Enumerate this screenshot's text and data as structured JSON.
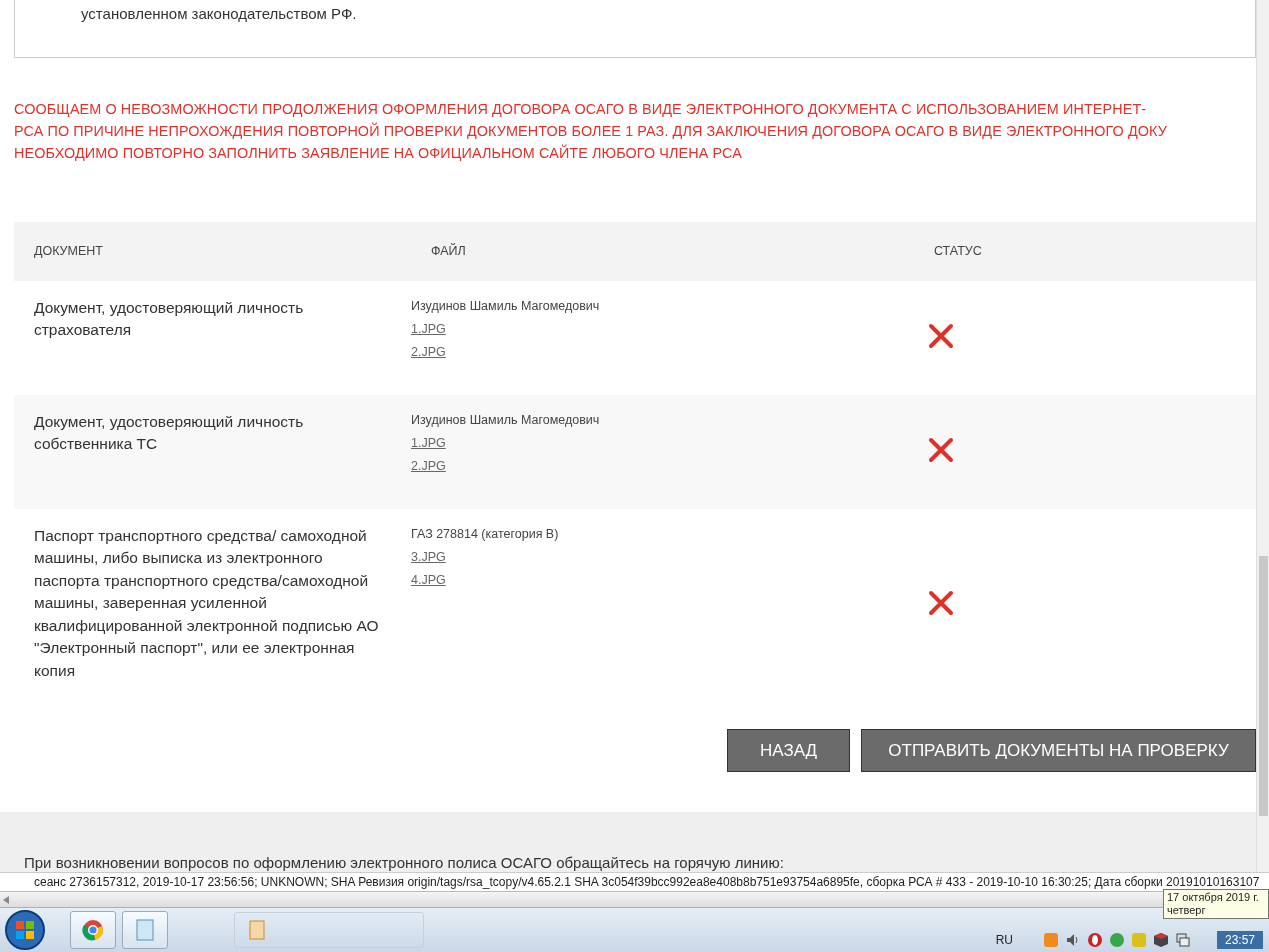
{
  "notice_box": {
    "text": "установленном законодательством РФ."
  },
  "message": {
    "lines": [
      "СООБЩАЕМ О НЕВОЗМОЖНОСТИ ПРОДОЛЖЕНИЯ ОФОРМЛЕНИЯ ДОГОВОРА ОСАГО В ВИДЕ ЭЛЕКТРОННОГО ДОКУМЕНТА С ИСПОЛЬЗОВАНИЕМ ИНТЕРНЕТ-",
      "РСА ПО ПРИЧИНЕ НЕПРОХОЖДЕНИЯ ПОВТОРНОЙ ПРОВЕРКИ ДОКУМЕНТОВ БОЛЕЕ 1 РАЗ. ДЛЯ ЗАКЛЮЧЕНИЯ ДОГОВОРА ОСАГО В ВИДЕ ЭЛЕКТРОННОГО ДОКУ",
      "НЕОБХОДИМО ПОВТОРНО ЗАПОЛНИТЬ ЗАЯВЛЕНИЕ НА ОФИЦИАЛЬНОМ САЙТЕ ЛЮБОГО ЧЛЕНА РСА"
    ]
  },
  "table": {
    "columns": [
      "ДОКУМЕНТ",
      "ФАЙЛ",
      "СТАТУС"
    ],
    "rows": [
      {
        "document": "Документ, удостоверяющий личность страхователя",
        "owner": "Изудинов Шамиль Магомедович",
        "files": [
          "1.JPG",
          "2.JPG"
        ],
        "accepted": false
      },
      {
        "document": "Документ, удостоверяющий личность собственника ТС",
        "owner": "Изудинов Шамиль Магомедович",
        "files": [
          "1.JPG",
          "2.JPG"
        ],
        "accepted": false
      },
      {
        "document": "Паспорт транспортного средства/ самоходной машины, либо выписка из электронного паспорта транспортного средства/самоходной машины, заверенная усиленной квалифицированной электронной подписью АО \"Электронный паспорт\", или ее электронная копия",
        "owner": "ГАЗ 278814 (категория В)",
        "files": [
          "3.JPG",
          "4.JPG"
        ],
        "accepted": false
      }
    ]
  },
  "buttons": [
    {
      "label": "НАЗАД"
    },
    {
      "label": "ОТПРАВИТЬ ДОКУМЕНТЫ НА ПРОВЕРКУ"
    }
  ],
  "footer": {
    "text": "При возникновении вопросов по оформлению электронного полиса ОСАГО обращайтесь на горячую линию:"
  },
  "status_line": {
    "text": "сеанс 2736157312, 2019-10-17 23:56:56; UNKNOWN; SHA Ревизия origin/tags/rsa_tcopy/v4.65.2.1 SHA 3c054f39bcc992ea8e408b8b751e93754a6895fe, сборка РСА # 433 - 2019-10-10 16:30:25; Дата сборки 20191010163107"
  },
  "taskbar": {
    "language": "RU",
    "time": "23:57"
  },
  "date_tooltip": {
    "date": "17 октября 2019 г.",
    "weekday": "четверг"
  }
}
